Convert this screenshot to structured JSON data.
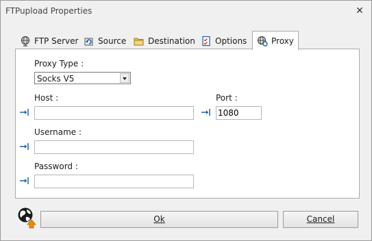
{
  "window": {
    "title": "FTPupload Properties"
  },
  "tabs": [
    {
      "label": "FTP Server",
      "icon": "globe-icon"
    },
    {
      "label": "Source",
      "icon": "refresh-icon"
    },
    {
      "label": "Destination",
      "icon": "folder-icon"
    },
    {
      "label": "Options",
      "icon": "checklist-icon"
    },
    {
      "label": "Proxy",
      "icon": "network-icon",
      "active": true
    }
  ],
  "proxy": {
    "type_label": "Proxy Type :",
    "type_value": "Socks V5",
    "host_label": "Host :",
    "host_value": "",
    "port_label": "Port :",
    "port_value": "1080",
    "username_label": "Username :",
    "username_value": "",
    "password_label": "Password :",
    "password_value": ""
  },
  "buttons": {
    "ok": "Ok",
    "cancel": "Cancel"
  },
  "colors": {
    "accent": "#1f5fa8",
    "upload_arrow": "#f08a00"
  }
}
